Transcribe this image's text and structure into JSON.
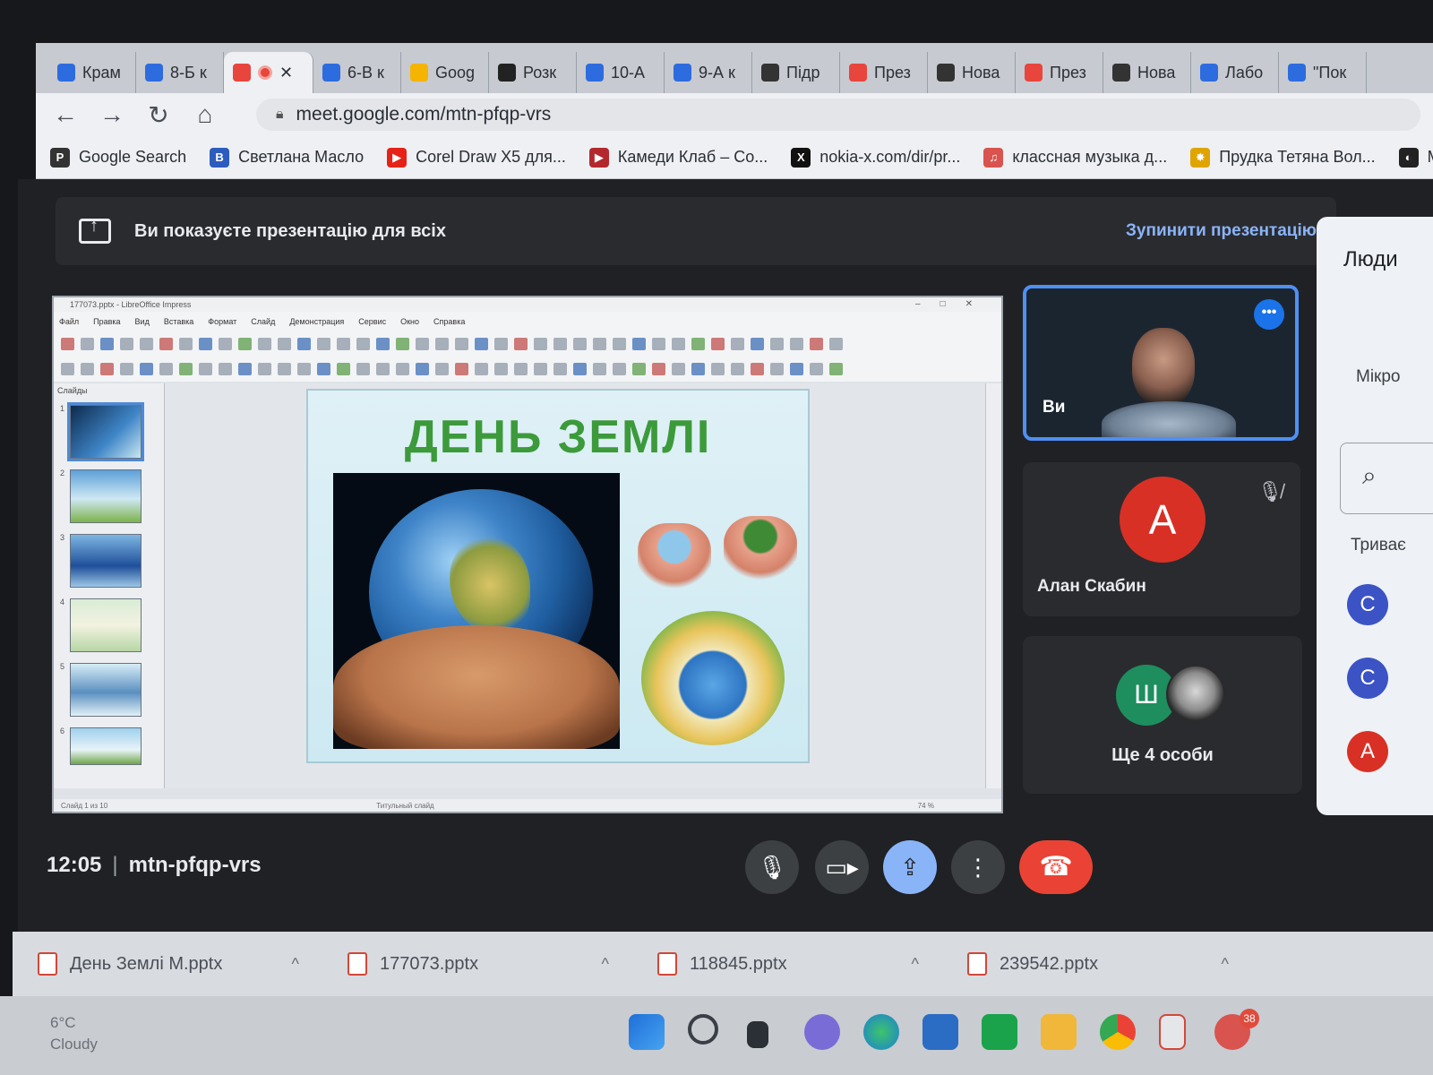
{
  "browser": {
    "tabs": [
      {
        "label": "Крам",
        "color": "#2d6cdf"
      },
      {
        "label": "8-Б к",
        "color": "#2d6cdf"
      },
      {
        "label": "",
        "color": "#e8453c",
        "active": true
      },
      {
        "label": "6-В к",
        "color": "#2d6cdf"
      },
      {
        "label": "Goog",
        "color": "#f4b400"
      },
      {
        "label": "Розк",
        "color": "#222222"
      },
      {
        "label": "10-А",
        "color": "#2d6cdf"
      },
      {
        "label": "9-А к",
        "color": "#2d6cdf"
      },
      {
        "label": "Підр",
        "color": "#333333"
      },
      {
        "label": "През",
        "color": "#e8453c"
      },
      {
        "label": "Нова",
        "color": "#333333"
      },
      {
        "label": "През",
        "color": "#e8453c"
      },
      {
        "label": "Нова",
        "color": "#333333"
      },
      {
        "label": "Лабо",
        "color": "#2d6cdf"
      },
      {
        "label": "\"Пок",
        "color": "#2d6cdf"
      }
    ],
    "active_tab_close": "✕",
    "url": "meet.google.com/mtn-pfqp-vrs",
    "bookmarks": [
      {
        "label": "Google Search",
        "icon": "P",
        "color": "#333333"
      },
      {
        "label": "Светлана Масло",
        "icon": "B",
        "color": "#2d5cbf"
      },
      {
        "label": "Corel Draw X5 для...",
        "icon": "▶",
        "color": "#e62117"
      },
      {
        "label": "Камеди Клаб – Co...",
        "icon": "▶",
        "color": "#b3282d"
      },
      {
        "label": "nokia-x.com/dir/pr...",
        "icon": "X",
        "color": "#111111"
      },
      {
        "label": "классная музыка д...",
        "icon": "♫",
        "color": "#d9534f"
      },
      {
        "label": "Прудка Тетяна Вол...",
        "icon": "✸",
        "color": "#e0a400"
      },
      {
        "label": "MFM",
        "icon": "◐",
        "color": "#222222"
      }
    ]
  },
  "meet": {
    "banner_text": "Ви показуєте презентацію для всіх",
    "stop_label": "Зупинити презентацію",
    "clock": "12:05",
    "meeting_code": "mtn-pfqp-vrs",
    "tiles": {
      "self_name": "Ви",
      "alan_initial": "А",
      "alan_name": "Алан Скабин",
      "more_initial": "Ш",
      "more_label": "Ще 4 особи"
    },
    "people_panel": {
      "title": "Люди",
      "mic_label": "Мікро",
      "duration_label": "Триває",
      "avatars": [
        {
          "initial": "С",
          "color": "#3b53c4"
        },
        {
          "initial": "С",
          "color": "#3b53c4"
        },
        {
          "initial": "А",
          "color": "#d93025"
        }
      ]
    }
  },
  "presentation": {
    "app_title": "177073.pptx - LibreOffice Impress",
    "menu": [
      "Файл",
      "Правка",
      "Вид",
      "Вставка",
      "Формат",
      "Слайд",
      "Демонстрация",
      "Сервис",
      "Окно",
      "Справка"
    ],
    "slides_header": "Слайды",
    "slide_title": "ДЕНЬ  ЗЕМЛІ",
    "status_slide": "Слайд 1 из 10",
    "status_layout": "Титульный слайд",
    "status_zoom": "74 %"
  },
  "downloads": [
    {
      "name": "День Землі М.pptx"
    },
    {
      "name": "177073.pptx"
    },
    {
      "name": "118845.pptx"
    },
    {
      "name": "239542.pptx"
    }
  ],
  "taskbar": {
    "temperature": "6°C",
    "weather": "Cloudy",
    "badge_count": "38"
  }
}
